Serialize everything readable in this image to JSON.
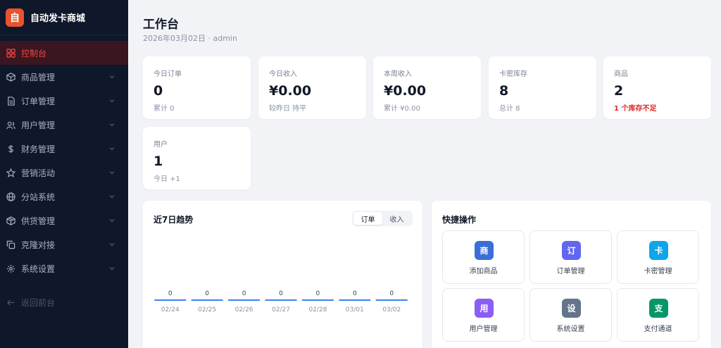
{
  "brand": {
    "logo_char": "自",
    "name": "自动发卡商城",
    "logo_color": "#e8532f"
  },
  "nav": {
    "items": [
      {
        "label": "控制台",
        "icon": "grid-icon",
        "active": true
      },
      {
        "label": "商品管理",
        "icon": "box-icon"
      },
      {
        "label": "订单管理",
        "icon": "document-icon"
      },
      {
        "label": "用户管理",
        "icon": "users-icon"
      },
      {
        "label": "财务管理",
        "icon": "dollar-icon"
      },
      {
        "label": "营销活动",
        "icon": "star-icon"
      },
      {
        "label": "分站系统",
        "icon": "globe-icon"
      },
      {
        "label": "供货管理",
        "icon": "package-icon"
      },
      {
        "label": "克隆对接",
        "icon": "copy-icon"
      },
      {
        "label": "系统设置",
        "icon": "gear-icon"
      }
    ],
    "back_label": "返回前台"
  },
  "header": {
    "title": "工作台",
    "subtitle": "2026年03月02日 · admin"
  },
  "stats": [
    {
      "label": "今日订单",
      "value": "0",
      "sub": "累计 0"
    },
    {
      "label": "今日收入",
      "value": "¥0.00",
      "sub": "较昨日 持平"
    },
    {
      "label": "本周收入",
      "value": "¥0.00",
      "sub": "累计 ¥0.00"
    },
    {
      "label": "卡密库存",
      "value": "8",
      "sub": "总计 8"
    },
    {
      "label": "商品",
      "value": "2",
      "sub": "1 个库存不足",
      "warn": true
    },
    {
      "label": "用户",
      "value": "1",
      "sub": "今日 +1"
    }
  ],
  "trend": {
    "title": "近7日趋势",
    "toggle": {
      "orders_label": "订单",
      "revenue_label": "收入",
      "selected": "订单"
    }
  },
  "chart_data": {
    "type": "bar",
    "title": "近7日趋势",
    "categories": [
      "02/24",
      "02/25",
      "02/26",
      "02/27",
      "02/28",
      "03/01",
      "03/02"
    ],
    "values": [
      0,
      0,
      0,
      0,
      0,
      0,
      0
    ],
    "data_labels": [
      "0",
      "0",
      "0",
      "0",
      "0",
      "0",
      "0"
    ],
    "color": "#3b82f6"
  },
  "quick": {
    "title": "快捷操作",
    "items": [
      {
        "char": "商",
        "label": "添加商品",
        "color": "#3b6fd8"
      },
      {
        "char": "订",
        "label": "订单管理",
        "color": "#6366f1"
      },
      {
        "char": "卡",
        "label": "卡密管理",
        "color": "#0ea5e9"
      },
      {
        "char": "用",
        "label": "用户管理",
        "color": "#8b5cf6"
      },
      {
        "char": "设",
        "label": "系统设置",
        "color": "#64748b"
      },
      {
        "char": "支",
        "label": "支付通道",
        "color": "#059669"
      }
    ]
  }
}
